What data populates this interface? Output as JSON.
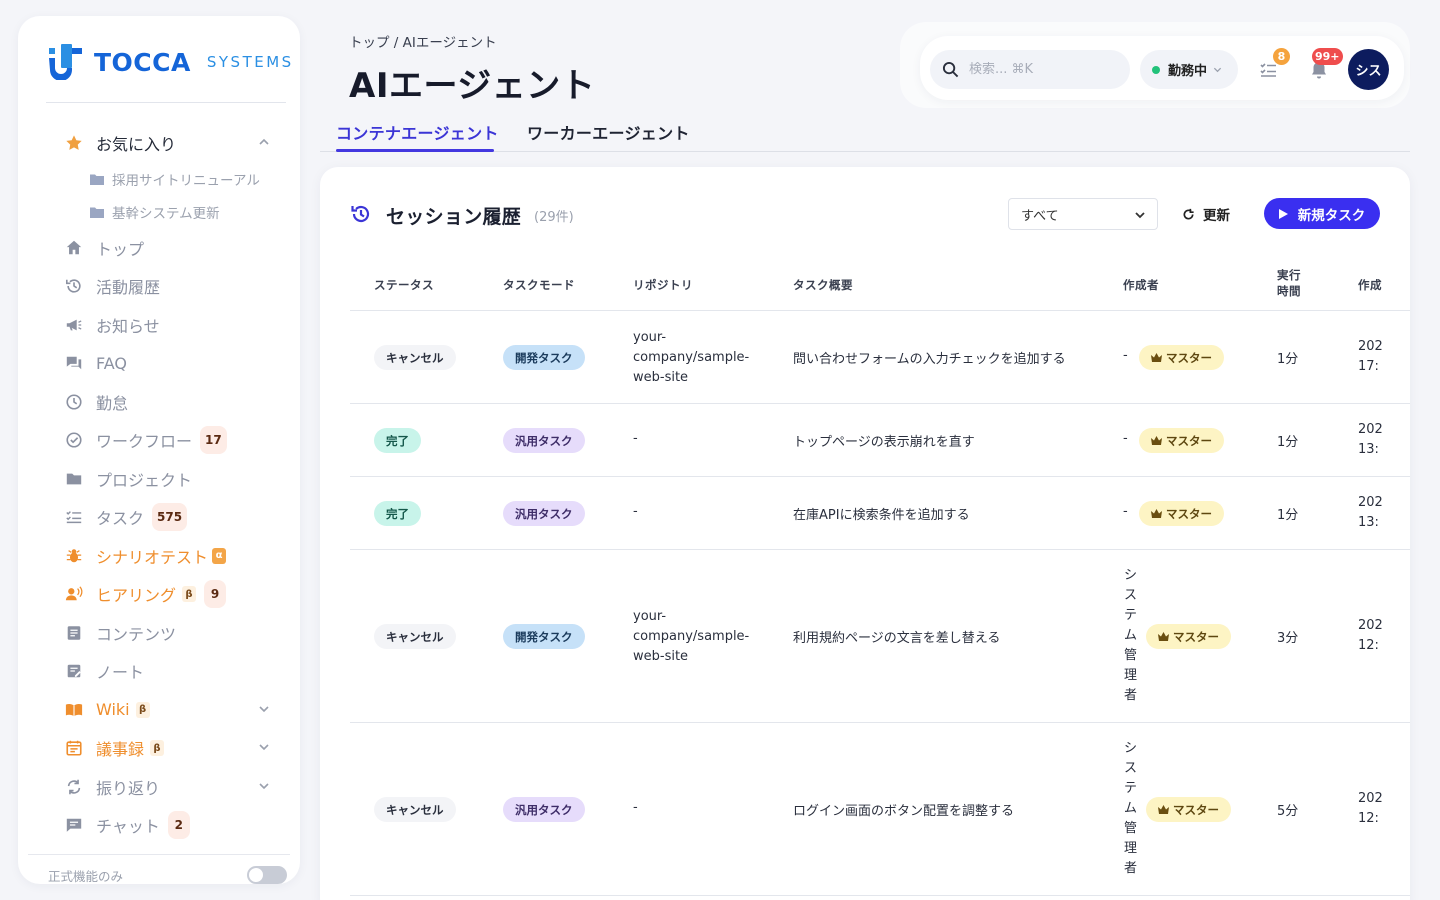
{
  "logo": {
    "name": "TOCCA",
    "sub": "SYSTEMS"
  },
  "sidebar": {
    "favorites": {
      "label": "お気に入り",
      "items": [
        "採用サイトリニューアル",
        "基幹システム更新"
      ]
    },
    "items": [
      {
        "label": "トップ"
      },
      {
        "label": "活動履歴"
      },
      {
        "label": "お知らせ"
      },
      {
        "label": "FAQ"
      },
      {
        "label": "勤怠"
      },
      {
        "label": "ワークフロー",
        "badge": "17"
      },
      {
        "label": "プロジェクト"
      },
      {
        "label": "タスク",
        "badge": "575"
      },
      {
        "label": "シナリオテスト",
        "tag": "α"
      },
      {
        "label": "ヒアリング",
        "tag": "β",
        "badge": "9"
      },
      {
        "label": "コンテンツ"
      },
      {
        "label": "ノート"
      },
      {
        "label": "Wiki",
        "tag": "β"
      },
      {
        "label": "議事録",
        "tag": "β"
      },
      {
        "label": "振り返り"
      },
      {
        "label": "チャット",
        "badge": "2"
      }
    ],
    "footer_label": "正式機能のみ"
  },
  "header": {
    "breadcrumb": "トップ / AIエージェント",
    "title": "AIエージェント",
    "search_placeholder": "検索... ⌘K",
    "status": "勤務中",
    "tasks_badge": "8",
    "notifications_badge": "99+",
    "avatar": "シス"
  },
  "tabs": [
    "コンテナエージェント",
    "ワーカーエージェント"
  ],
  "session": {
    "title": "セッション履歴",
    "count": "(29件)",
    "filter": "すべて",
    "refresh": "更新",
    "new_task": "新規タスク",
    "columns": {
      "status": "ステータス",
      "mode": "タスクモード",
      "repo": "リポジトリ",
      "summary": "タスク概要",
      "author": "作成者",
      "duration_1": "実行",
      "duration_2": "時間",
      "created": "作成"
    },
    "rows": [
      {
        "status": "キャンセル",
        "mode": "開発タスク",
        "repo": "your-company/sample-web-site",
        "summary": "問い合わせフォームの入力チェックを追加する",
        "author": "-",
        "role": "マスター",
        "duration": "1分",
        "date1": "202",
        "date2": "17:"
      },
      {
        "status": "完了",
        "mode": "汎用タスク",
        "repo": "-",
        "summary": "トップページの表示崩れを直す",
        "author": "-",
        "role": "マスター",
        "duration": "1分",
        "date1": "202",
        "date2": "13:"
      },
      {
        "status": "完了",
        "mode": "汎用タスク",
        "repo": "-",
        "summary": "在庫APIに検索条件を追加する",
        "author": "-",
        "role": "マスター",
        "duration": "1分",
        "date1": "202",
        "date2": "13:"
      },
      {
        "status": "キャンセル",
        "mode": "開発タスク",
        "repo": "your-company/sample-web-site",
        "summary": "利用規約ページの文言を差し替える",
        "author": "システム管理者",
        "role": "マスター",
        "duration": "3分",
        "date1": "202",
        "date2": "12:"
      },
      {
        "status": "キャンセル",
        "mode": "汎用タスク",
        "repo": "-",
        "summary": "ログイン画面のボタン配置を調整する",
        "author": "システム管理者",
        "role": "マスター",
        "duration": "5分",
        "date1": "202",
        "date2": "12:"
      }
    ]
  }
}
